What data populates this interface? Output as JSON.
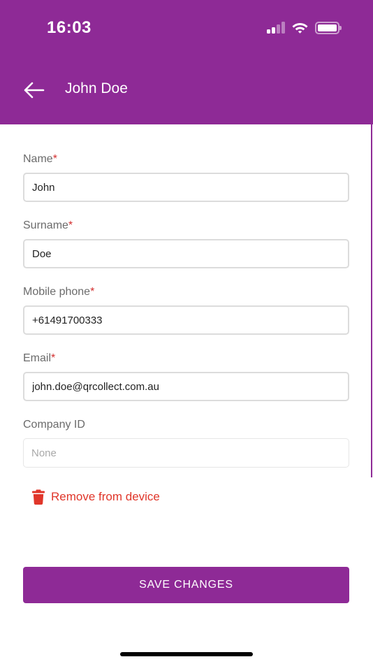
{
  "status_bar": {
    "time": "16:03",
    "icons": [
      "cellular-signal-icon",
      "wifi-icon",
      "battery-icon"
    ]
  },
  "app_bar": {
    "back_icon": "arrow-left-icon",
    "title": "John Doe"
  },
  "form": {
    "required_marker": "*",
    "fields": [
      {
        "label": "Name",
        "required": true,
        "value": "John",
        "placeholder": ""
      },
      {
        "label": "Surname",
        "required": true,
        "value": "Doe",
        "placeholder": ""
      },
      {
        "label": "Mobile phone",
        "required": true,
        "value": "+61491700333",
        "placeholder": ""
      },
      {
        "label": "Email",
        "required": true,
        "value": "john.doe@qrcollect.com.au",
        "placeholder": ""
      },
      {
        "label": "Company ID",
        "required": false,
        "value": "",
        "placeholder": "None",
        "disabled": true
      }
    ]
  },
  "actions": {
    "remove_label": "Remove from device",
    "remove_icon": "trash-icon",
    "save_label": "SAVE CHANGES"
  },
  "colors": {
    "primary": "#8e2a96",
    "required": "#d32f2f",
    "danger": "#e0362a",
    "label": "#6b6b6b"
  }
}
